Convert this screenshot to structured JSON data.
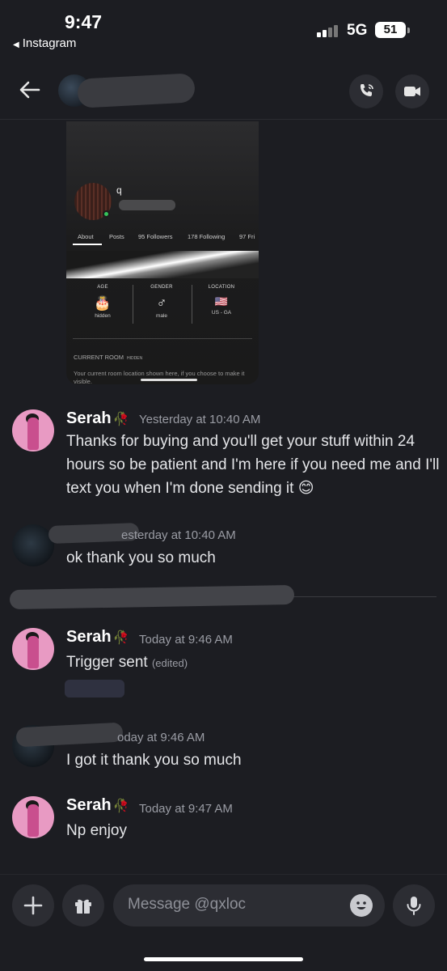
{
  "status_bar": {
    "time": "9:47",
    "back_app": "Instagram",
    "network": "5G",
    "battery": "51"
  },
  "header": {
    "back_icon": "arrow-left-icon",
    "call_icon": "phone-icon",
    "video_icon": "video-camera-icon"
  },
  "embedded_profile": {
    "name": "q",
    "tabs": [
      "About",
      "Posts",
      "95 Followers",
      "178 Following",
      "97 Fri"
    ],
    "cells": [
      {
        "label": "AGE",
        "icon": "birthday-cake-icon",
        "glyph": "🎂",
        "value": "hidden"
      },
      {
        "label": "GENDER",
        "icon": "male-icon",
        "glyph": "♂",
        "value": "male"
      },
      {
        "label": "LOCATION",
        "icon": "us-flag-icon",
        "glyph": "🇺🇸",
        "value": "US - GA"
      }
    ],
    "current_room": "CURRENT ROOM",
    "current_room_badge": "HIDDEN",
    "room_description": "Your current room location shown here, if you choose to make it visible."
  },
  "messages": [
    {
      "author": "Serah",
      "decoration": "🥀",
      "timestamp": "Yesterday at 10:40 AM",
      "text": "Thanks for buying and you'll get your stuff within 24 hours so be patient and I'm here if you need me and I'll text you when I'm done sending it 😊"
    },
    {
      "author": "",
      "timestamp": "esterday at 10:40 AM",
      "text": "ok thank you so much"
    },
    {
      "author": "Serah",
      "decoration": "🥀",
      "timestamp": "Today at 9:46 AM",
      "text": "Trigger sent",
      "edited": "(edited)"
    },
    {
      "author": "",
      "timestamp": "oday at 9:46 AM",
      "text": "I got it thank you so much"
    },
    {
      "author": "Serah",
      "decoration": "🥀",
      "timestamp": "Today at 9:47 AM",
      "text": "Np enjoy"
    }
  ],
  "input": {
    "placeholder": "Message @qxloc",
    "add_icon": "plus-icon",
    "gift_icon": "gift-icon",
    "emoji_icon": "emoji-icon",
    "mic_icon": "microphone-icon"
  }
}
